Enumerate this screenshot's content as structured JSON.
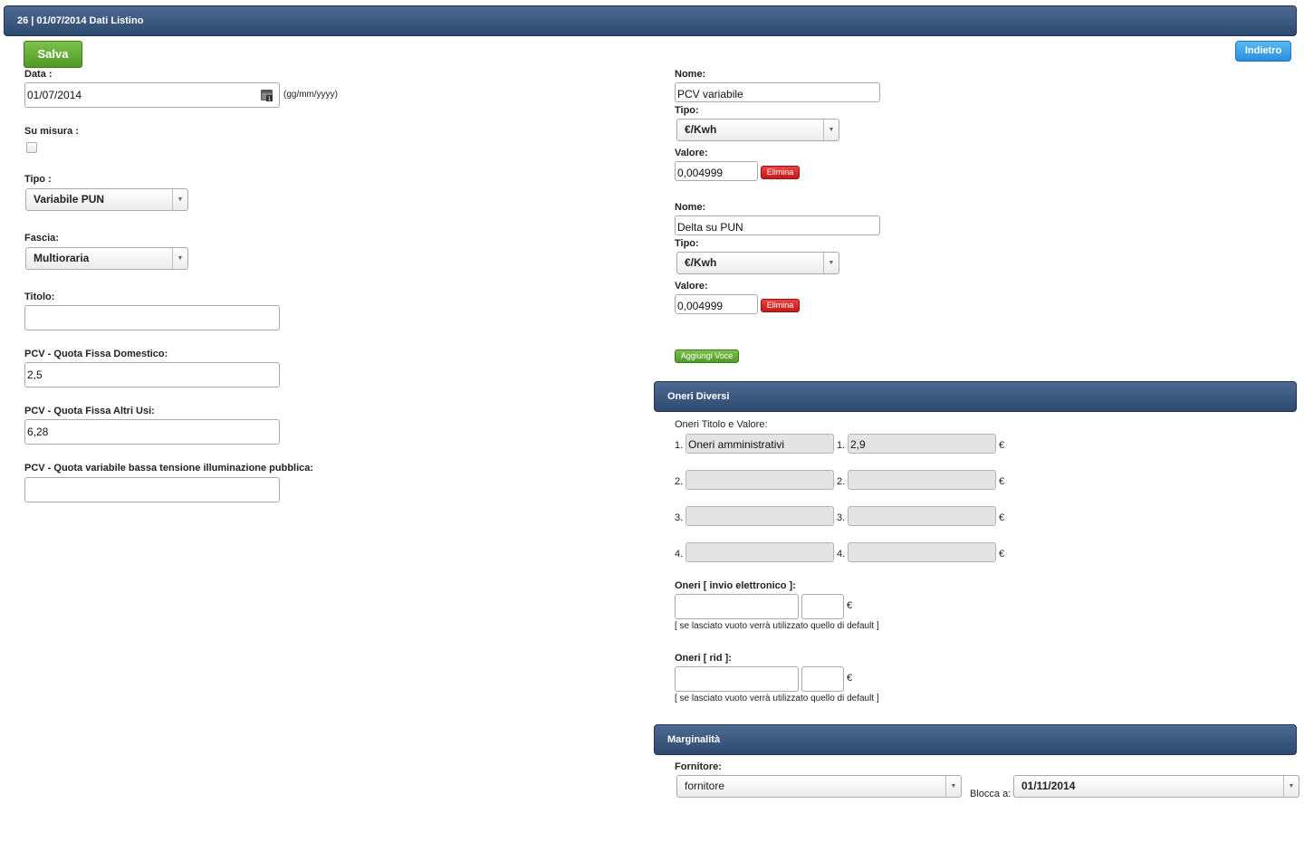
{
  "header": {
    "title": "26 | 01/07/2014 Dati Listino"
  },
  "toolbar": {
    "save_label": "Salva",
    "back_label": "Indietro"
  },
  "left": {
    "date_label": "Data :",
    "date_value": "01/07/2014",
    "date_icon": "calendar-icon",
    "date_format": "(gg/mm/yyyy)",
    "su_misura_label": "Su misura :",
    "su_misura_checked": false,
    "tipo_label": "Tipo :",
    "tipo_value": "Variabile PUN",
    "fascia_label": "Fascia:",
    "fascia_value": "Multioraria",
    "titolo_label": "Titolo:",
    "titolo_value": "",
    "qf_dom_label": "PCV - Quota Fissa Domestico:",
    "qf_dom_value": "2,5",
    "qf_altri_label": "PCV - Quota Fissa Altri Usi:",
    "qf_altri_value": "6,28",
    "qv_label": "PCV - Quota variabile bassa tensione illuminazione pubblica:",
    "qv_value": ""
  },
  "voci": {
    "name_label": "Nome:",
    "type_label": "Tipo:",
    "value_label": "Valore:",
    "delete_label": "Elimina",
    "add_label": "Aggiungi Voce",
    "items": [
      {
        "name": "PCV variabile",
        "type": "€/Kwh",
        "value": "0,004999"
      },
      {
        "name": "Delta su PUN",
        "type": "€/Kwh",
        "value": "0,004999"
      }
    ]
  },
  "oneri": {
    "section_title": "Oneri Diversi",
    "titolo_valore_label": "Oneri Titolo e Valore:",
    "currency": "€",
    "rows": [
      {
        "num": "1.",
        "title": "Oneri amministrativi",
        "value": "2,9"
      },
      {
        "num": "2.",
        "title": "",
        "value": ""
      },
      {
        "num": "3.",
        "title": "",
        "value": ""
      },
      {
        "num": "4.",
        "title": "",
        "value": ""
      }
    ],
    "invio_label": "Oneri [ invio elettronico ]:",
    "invio_title": "",
    "invio_value": "",
    "default_note": "[ se lasciato vuoto verrà utilizzato quello di default ]",
    "rid_label": "Oneri [ rid ]:",
    "rid_title": "",
    "rid_value": ""
  },
  "marginalita": {
    "section_title": "Marginalità",
    "fornitore_label": "Fornitore:",
    "fornitore_value": "fornitore",
    "blocca_label": "Blocca a:",
    "blocca_value": "01/11/2014"
  }
}
